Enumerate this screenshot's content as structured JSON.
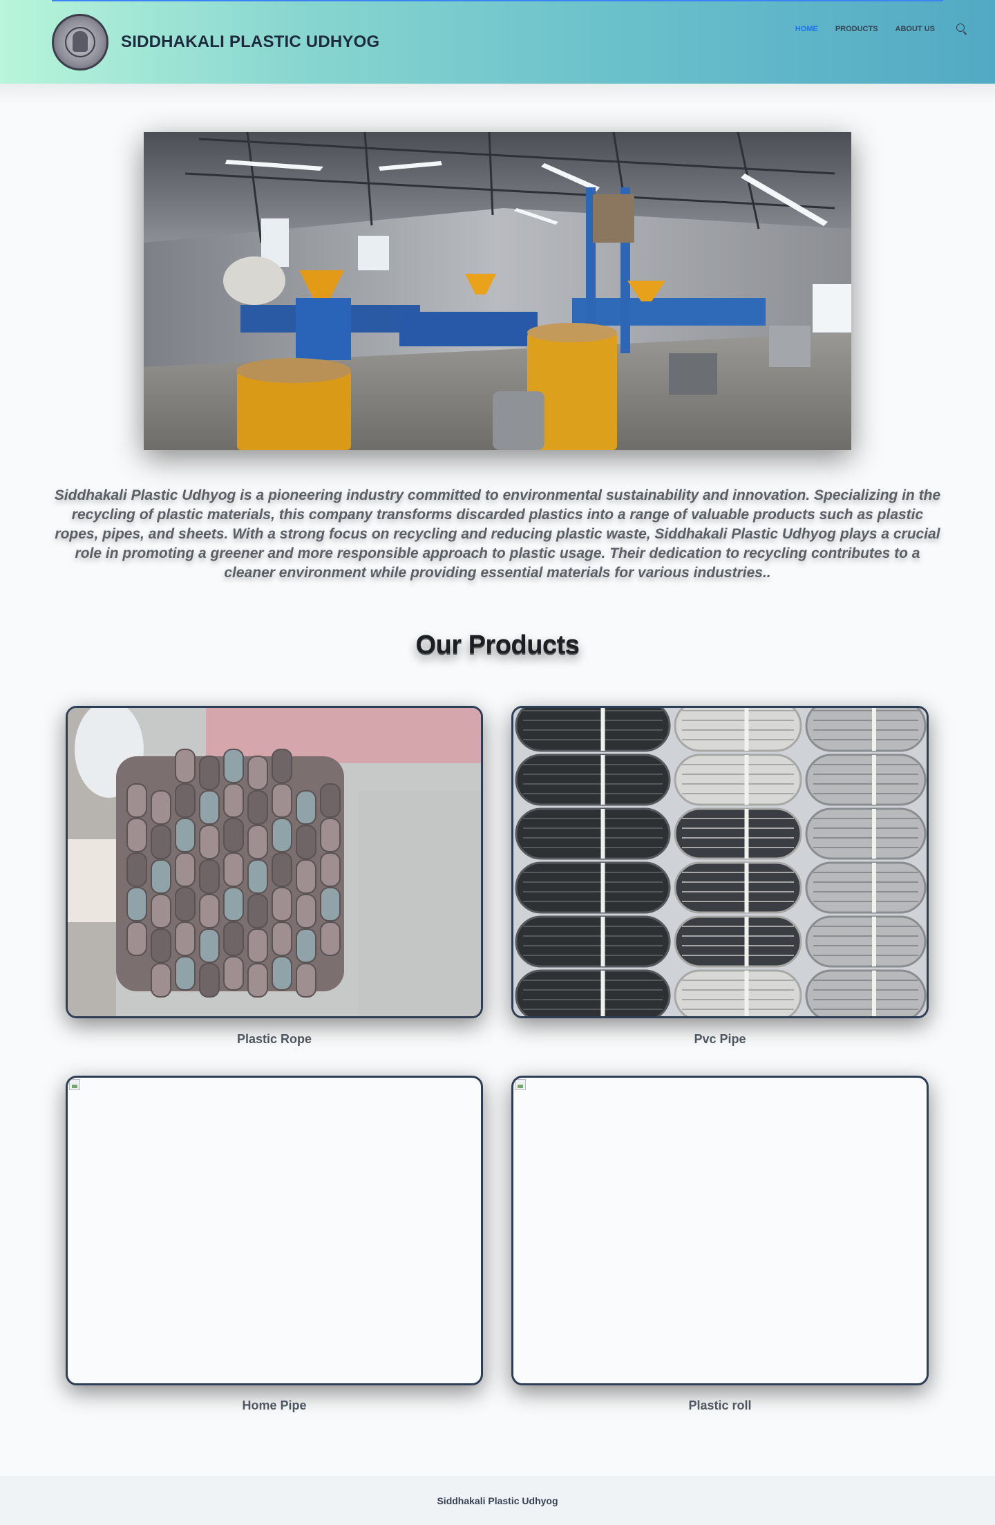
{
  "header": {
    "brand": "SIDDHAKALI PLASTIC UDHYOG",
    "nav": [
      {
        "label": "HOME",
        "active": true
      },
      {
        "label": "PRODUCTS",
        "active": false
      },
      {
        "label": "ABOUT US",
        "active": false
      }
    ],
    "search_icon": "search-icon",
    "gradient_colors": [
      "#b8f5da",
      "#52a9c4"
    ],
    "accent_color": "#1d6ff2"
  },
  "hero": {
    "image_alt": "Factory interior with plastic recycling machines"
  },
  "about": {
    "text": "Siddhakali Plastic Udhyog is a pioneering industry committed to environmental sustainability and innovation. Specializing in the recycling of plastic materials, this company transforms discarded plastics into a range of valuable products such as plastic ropes, pipes, and sheets. With a strong focus on recycling and reducing plastic waste, Siddhakali Plastic Udhyog plays a crucial role in promoting a greener and more responsible approach to plastic usage. Their dedication to recycling contributes to a cleaner environment while providing essential materials for various industries.."
  },
  "products": {
    "title": "Our Products",
    "items": [
      {
        "label": "Plastic Rope",
        "image": "bundles of plastic rope rolls"
      },
      {
        "label": "Pvc Pipe",
        "image": "stacked coils of black and white pipe"
      },
      {
        "label": "Home Pipe",
        "image": "broken image"
      },
      {
        "label": "Plastic roll",
        "image": "broken image"
      }
    ]
  },
  "footer": {
    "text": "Siddhakali Plastic Udhyog"
  }
}
